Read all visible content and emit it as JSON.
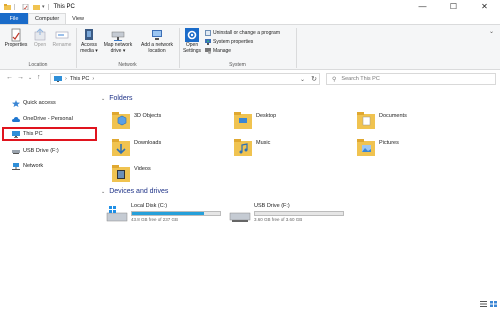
{
  "window": {
    "title": "This PC",
    "caption": {
      "minimize": "—",
      "maximize": "☐",
      "close": "✕"
    }
  },
  "tabs": [
    {
      "label": "File"
    },
    {
      "label": "Computer"
    },
    {
      "label": "View"
    }
  ],
  "ribbon": {
    "location": {
      "properties": "Properties",
      "open": "Open",
      "rename": "Rename",
      "group_label": "Location"
    },
    "network": {
      "access_media_1": "Access",
      "access_media_2": "media ▾",
      "map_drive_1": "Map network",
      "map_drive_2": "drive ▾",
      "add_location_1": "Add a network",
      "add_location_2": "location",
      "group_label": "Network"
    },
    "system": {
      "open_settings_1": "Open",
      "open_settings_2": "Settings",
      "uninstall": "Uninstall or change a program",
      "system_properties": "System properties",
      "manage": "Manage",
      "group_label": "System"
    }
  },
  "address": {
    "back": "←",
    "forward": "→",
    "recent": "⌄",
    "up": "↑",
    "path": "This PC",
    "separator": "›",
    "dropdown": "⌄",
    "refresh": "↻",
    "search_placeholder": "Search This PC"
  },
  "sidebar": {
    "items": [
      {
        "label": "Quick access",
        "icon": "star-icon"
      },
      {
        "label": "OneDrive - Personal",
        "icon": "cloud-icon"
      },
      {
        "label": "This PC",
        "icon": "pc-icon"
      },
      {
        "label": "USB Drive (F:)",
        "icon": "usb-drive-icon"
      },
      {
        "label": "Network",
        "icon": "network-icon"
      }
    ]
  },
  "main": {
    "folders_header": "Folders",
    "folders": [
      {
        "label": "3D Objects"
      },
      {
        "label": "Desktop"
      },
      {
        "label": "Documents"
      },
      {
        "label": "Downloads"
      },
      {
        "label": "Music"
      },
      {
        "label": "Pictures"
      },
      {
        "label": "Videos"
      }
    ],
    "devices_header": "Devices and drives",
    "drives": [
      {
        "label": "Local Disk (C:)",
        "free": "43.8 GB free of 237 GB",
        "used_fraction": 0.815
      },
      {
        "label": "USB Drive (F:)",
        "free": "3.60 GB free of 3.60 GB",
        "used_fraction": 0.0
      }
    ]
  },
  "colors": {
    "accent": "#1a6bc9",
    "folder": "#f0c350",
    "drive_bar": "#26a0da",
    "selection_outline": "#e0141e"
  }
}
